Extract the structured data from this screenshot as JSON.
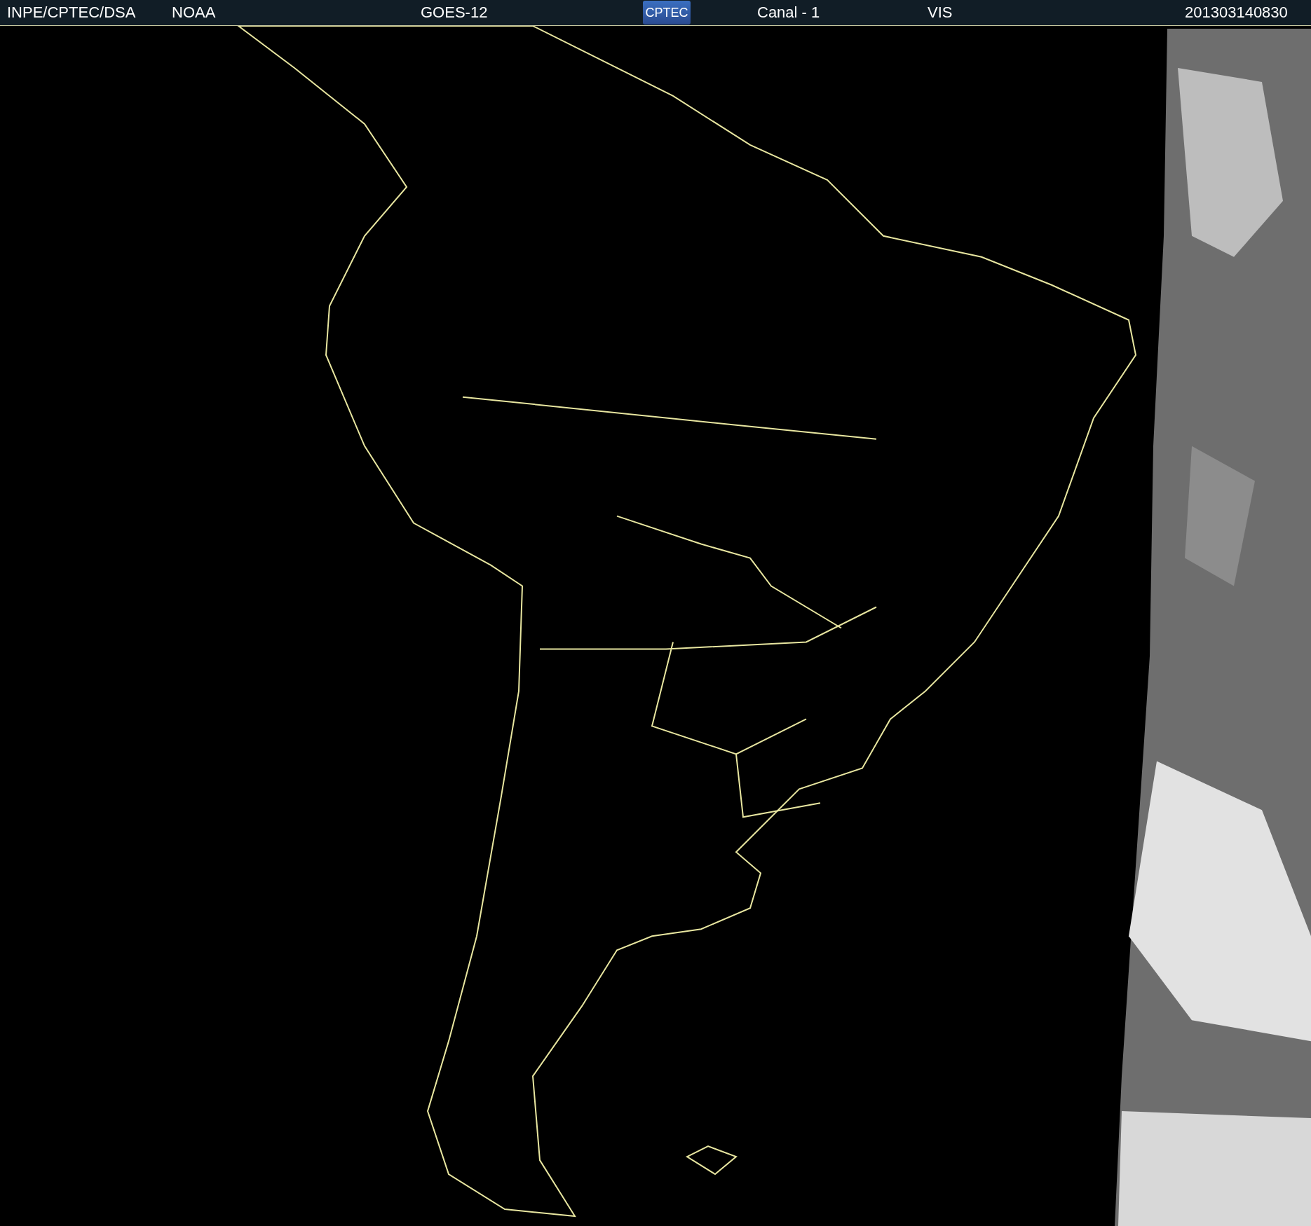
{
  "header": {
    "source": "INPE/CPTEC/DSA",
    "agency": "NOAA",
    "satellite": "GOES-12",
    "logo": "CPTEC",
    "channel": "Canal - 1",
    "band": "VIS",
    "timestamp": "201303140830"
  }
}
